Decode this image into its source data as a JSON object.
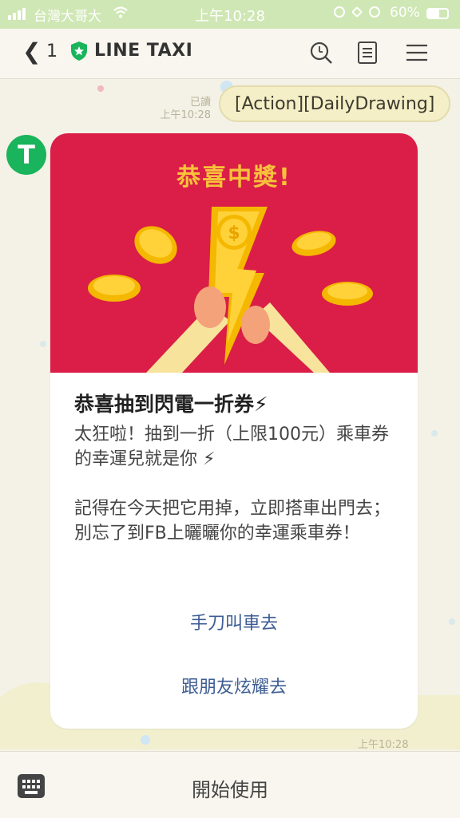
{
  "status_bar": {
    "carrier": "台灣大哥大",
    "time": "上午10:28",
    "battery": "60%",
    "battery_level": 0.6
  },
  "header": {
    "back_count": "1",
    "title": "LINE TAXI",
    "icons": [
      "search-icon",
      "notes-icon",
      "menu-icon"
    ]
  },
  "chat": {
    "user_message": {
      "read_label": "已讀",
      "time": "上午10:28",
      "text": "[Action][DailyDrawing]"
    },
    "bot_avatar": "T",
    "card": {
      "hero_title": "恭喜中獎!",
      "headline": "恭喜抽到閃電一折券⚡",
      "paragraph1": "太狂啦！抽到一折（上限100元）乘車券的幸運兒就是你 ⚡",
      "paragraph2": "記得在今天把它用掉，立即搭車出門去；別忘了到FB上曬曬你的幸運乘車券！",
      "action1": "手刀叫車去",
      "action2": "跟朋友炫耀去"
    },
    "card_time": "上午10:28"
  },
  "bottom_bar": {
    "start_label": "開始使用"
  },
  "colors": {
    "hero_red": "#da1e47",
    "hero_title_gold": "#f8c23b",
    "line_green": "#19b45b",
    "link_blue": "#3c5c93"
  }
}
